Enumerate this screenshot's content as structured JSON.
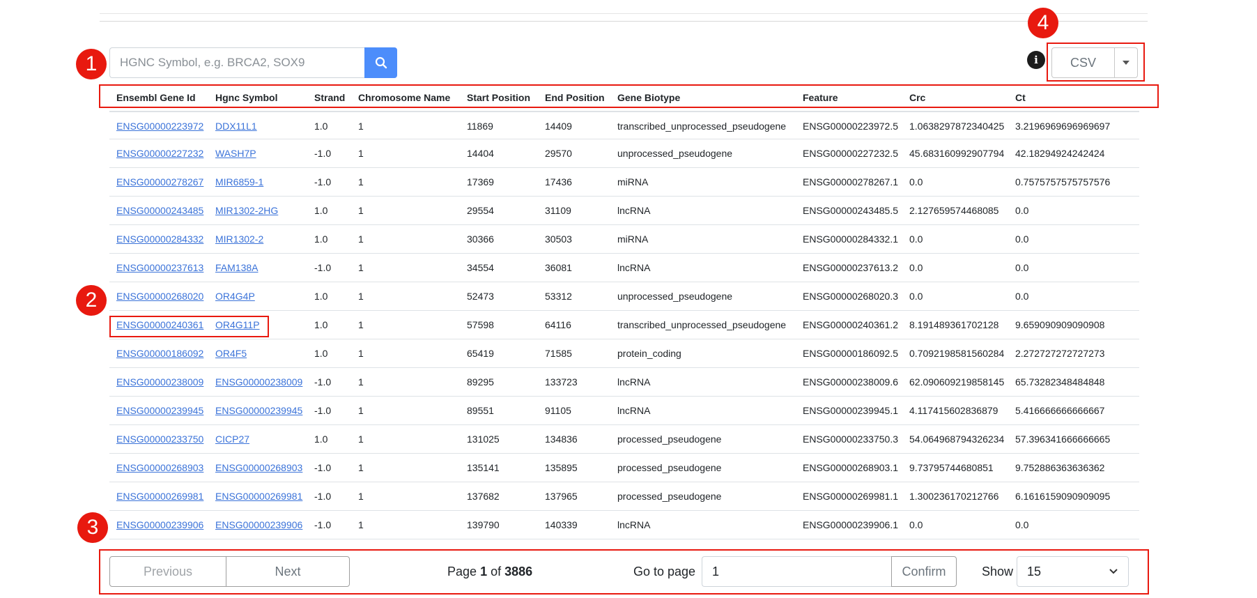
{
  "search": {
    "placeholder": "HGNC Symbol, e.g. BRCA2, SOX9",
    "button_icon": "search-icon"
  },
  "export": {
    "info_icon": "info-icon",
    "format_label": "CSV",
    "caret_icon": "caret-down-icon"
  },
  "markers": [
    "1",
    "2",
    "3",
    "4"
  ],
  "table": {
    "columns": [
      "Ensembl Gene Id",
      "Hgnc Symbol",
      "Strand",
      "Chromosome Name",
      "Start Position",
      "End Position",
      "Gene Biotype",
      "Feature",
      "Crc",
      "Ct"
    ],
    "rows": [
      [
        "ENSG00000223972",
        "DDX11L1",
        "1.0",
        "1",
        "11869",
        "14409",
        "transcribed_unprocessed_pseudogene",
        "ENSG00000223972.5",
        "1.0638297872340425",
        "3.2196969696969697"
      ],
      [
        "ENSG00000227232",
        "WASH7P",
        "-1.0",
        "1",
        "14404",
        "29570",
        "unprocessed_pseudogene",
        "ENSG00000227232.5",
        "45.683160992907794",
        "42.18294924242424"
      ],
      [
        "ENSG00000278267",
        "MIR6859-1",
        "-1.0",
        "1",
        "17369",
        "17436",
        "miRNA",
        "ENSG00000278267.1",
        "0.0",
        "0.7575757575757576"
      ],
      [
        "ENSG00000243485",
        "MIR1302-2HG",
        "1.0",
        "1",
        "29554",
        "31109",
        "lncRNA",
        "ENSG00000243485.5",
        "2.127659574468085",
        "0.0"
      ],
      [
        "ENSG00000284332",
        "MIR1302-2",
        "1.0",
        "1",
        "30366",
        "30503",
        "miRNA",
        "ENSG00000284332.1",
        "0.0",
        "0.0"
      ],
      [
        "ENSG00000237613",
        "FAM138A",
        "-1.0",
        "1",
        "34554",
        "36081",
        "lncRNA",
        "ENSG00000237613.2",
        "0.0",
        "0.0"
      ],
      [
        "ENSG00000268020",
        "OR4G4P",
        "1.0",
        "1",
        "52473",
        "53312",
        "unprocessed_pseudogene",
        "ENSG00000268020.3",
        "0.0",
        "0.0"
      ],
      [
        "ENSG00000240361",
        "OR4G11P",
        "1.0",
        "1",
        "57598",
        "64116",
        "transcribed_unprocessed_pseudogene",
        "ENSG00000240361.2",
        "8.191489361702128",
        "9.659090909090908"
      ],
      [
        "ENSG00000186092",
        "OR4F5",
        "1.0",
        "1",
        "65419",
        "71585",
        "protein_coding",
        "ENSG00000186092.5",
        "0.7092198581560284",
        "2.272727272727273"
      ],
      [
        "ENSG00000238009",
        "ENSG00000238009",
        "-1.0",
        "1",
        "89295",
        "133723",
        "lncRNA",
        "ENSG00000238009.6",
        "62.090609219858145",
        "65.73282348484848"
      ],
      [
        "ENSG00000239945",
        "ENSG00000239945",
        "-1.0",
        "1",
        "89551",
        "91105",
        "lncRNA",
        "ENSG00000239945.1",
        "4.117415602836879",
        "5.416666666666667"
      ],
      [
        "ENSG00000233750",
        "CICP27",
        "1.0",
        "1",
        "131025",
        "134836",
        "processed_pseudogene",
        "ENSG00000233750.3",
        "54.064968794326234",
        "57.396341666666665"
      ],
      [
        "ENSG00000268903",
        "ENSG00000268903",
        "-1.0",
        "1",
        "135141",
        "135895",
        "processed_pseudogene",
        "ENSG00000268903.1",
        "9.73795744680851",
        "9.752886363636362"
      ],
      [
        "ENSG00000269981",
        "ENSG00000269981",
        "-1.0",
        "1",
        "137682",
        "137965",
        "processed_pseudogene",
        "ENSG00000269981.1",
        "1.300236170212766",
        "6.1616159090909095"
      ],
      [
        "ENSG00000239906",
        "ENSG00000239906",
        "-1.0",
        "1",
        "139790",
        "140339",
        "lncRNA",
        "ENSG00000239906.1",
        "0.0",
        "0.0"
      ]
    ]
  },
  "pagination": {
    "previous_label": "Previous",
    "next_label": "Next",
    "page_prefix": "Page",
    "current_page": "1",
    "page_of": "of",
    "total_pages": "3886",
    "goto_label": "Go to page",
    "goto_value": "1",
    "confirm_label": "Confirm",
    "show_label": "Show",
    "show_value": "15",
    "show_icon": "chevron-down-icon"
  },
  "colors": {
    "accent": "#4c8dfb",
    "link": "#3b73d9",
    "annotation": "#e8190f"
  }
}
